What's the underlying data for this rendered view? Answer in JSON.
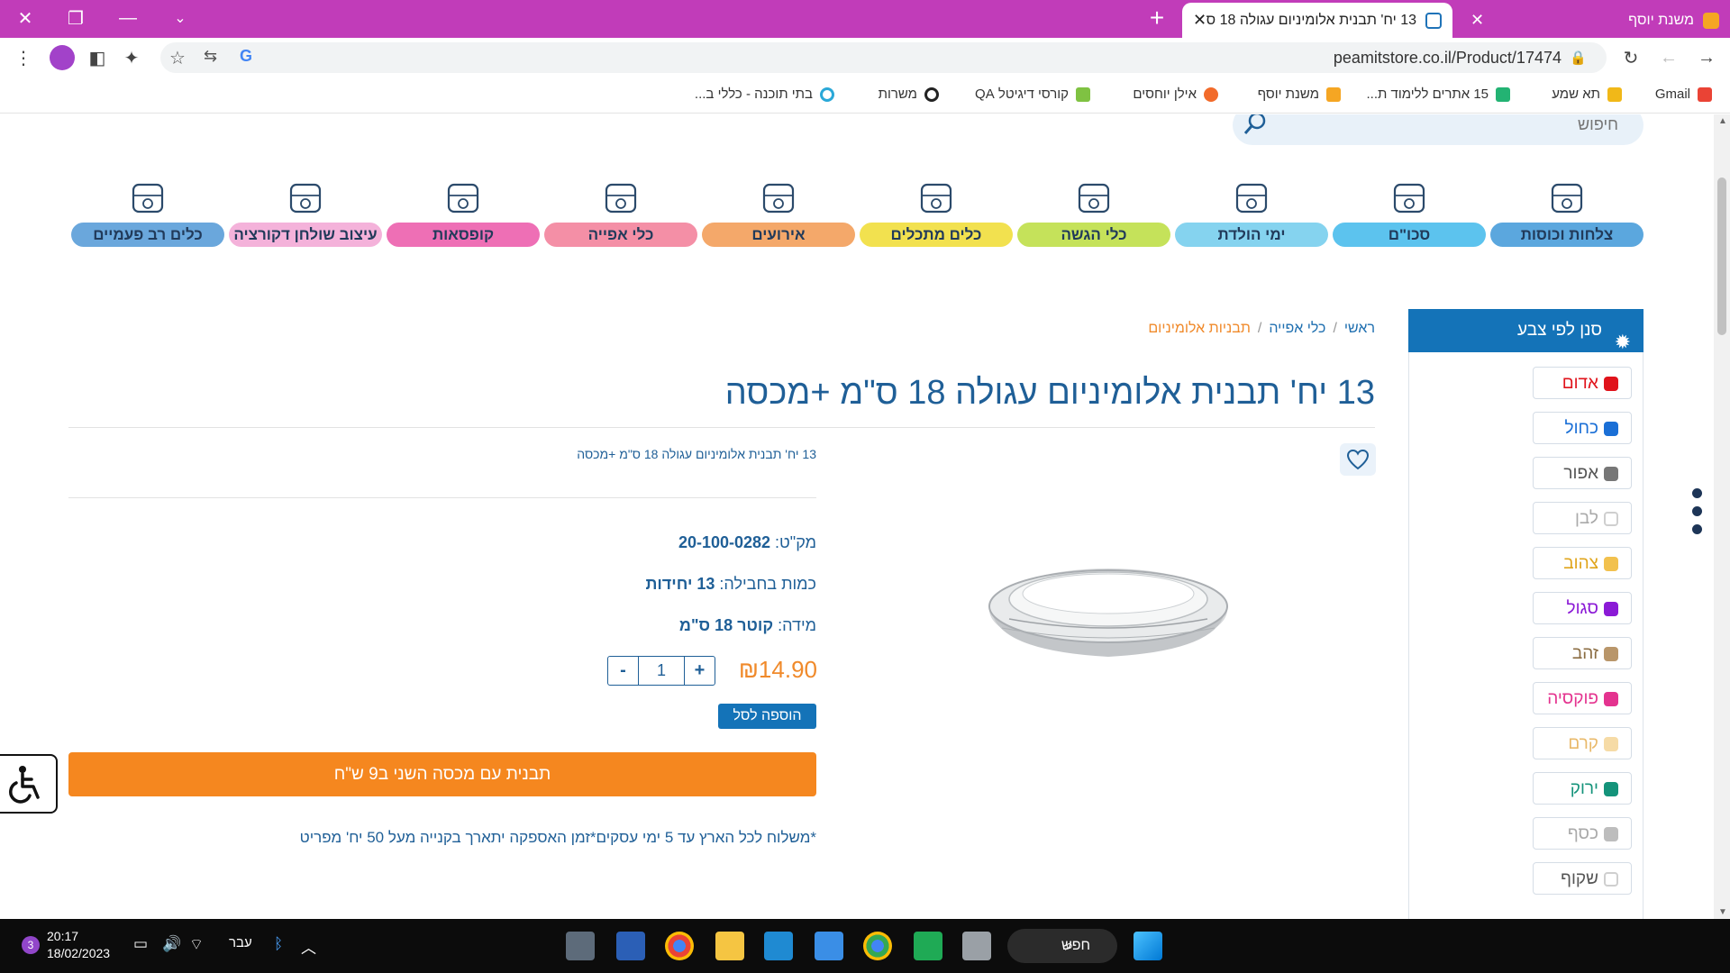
{
  "browser": {
    "tabs": [
      {
        "title": "13 יח' תבנית אלומיניום עגולה 18 ס",
        "active": true
      },
      {
        "title": "משנת יוסף",
        "active": false
      }
    ],
    "url": "peamitstore.co.il/Product/17474",
    "bookmarks": [
      "Gmail",
      "תא שמע",
      "15 אתרים ללימוד ת...",
      "משנת יוסף",
      "אילן יוחסים",
      "קורסי דיגיטל QA",
      "משרות",
      "בתי תוכנה - כללי ב..."
    ]
  },
  "site": {
    "search_placeholder": "חיפוש",
    "categories": [
      {
        "label": "צלחות וכוסות",
        "color": "#5ba7de",
        "icon": "cup-plate-icon"
      },
      {
        "label": "סכו\"ם",
        "color": "#5cc3ee",
        "icon": "cutlery-icon"
      },
      {
        "label": "ימי הולדת",
        "color": "#85d3ef",
        "icon": "balloons-icon"
      },
      {
        "label": "כלי הגשה",
        "color": "#c5e25a",
        "icon": "serving-dome-icon"
      },
      {
        "label": "כלים מתכלים",
        "color": "#f2e14f",
        "icon": "leaves-icon"
      },
      {
        "label": "אירועים",
        "color": "#f4a86a",
        "icon": "wine-glasses-icon"
      },
      {
        "label": "כלי אפייה",
        "color": "#f48fa6",
        "icon": "cupcake-icon"
      },
      {
        "label": "קופסאות",
        "color": "#ee6fb5",
        "icon": "boxes-icon"
      },
      {
        "label": "עיצוב שולחן דקורציה",
        "color": "#f4b2da",
        "icon": "tablecloth-icon"
      },
      {
        "label": "כלים רב פעמיים",
        "color": "#6aa7dc",
        "icon": "containers-icon"
      }
    ]
  },
  "filter": {
    "title": "סנן לפי צבע",
    "colors": [
      {
        "label": "אדום",
        "swatch": "#e0131b",
        "text": "#e0131b"
      },
      {
        "label": "כחול",
        "swatch": "#1a6fd6",
        "text": "#1a6fd6"
      },
      {
        "label": "אפור",
        "swatch": "#777777",
        "text": "#555555"
      },
      {
        "label": "לבן",
        "swatch": "#ffffff",
        "text": "#aaaaaa"
      },
      {
        "label": "צהוב",
        "swatch": "#f2c14e",
        "text": "#e0a51c"
      },
      {
        "label": "סגול",
        "swatch": "#8b1ad6",
        "text": "#8b1ad6"
      },
      {
        "label": "זהב",
        "swatch": "#b9966a",
        "text": "#8b6d43"
      },
      {
        "label": "פוקסיה",
        "swatch": "#e4338f",
        "text": "#e4338f"
      },
      {
        "label": "קרם",
        "swatch": "#f6dba6",
        "text": "#e9b96a"
      },
      {
        "label": "ירוק",
        "swatch": "#14937a",
        "text": "#14937a"
      },
      {
        "label": "כסף",
        "swatch": "#bdbdbd",
        "text": "#aaaaaa"
      },
      {
        "label": "שקוף",
        "swatch": "#ffffff",
        "text": "#555555"
      }
    ]
  },
  "product": {
    "breadcrumb": {
      "home": "ראשי",
      "category": "כלי אפייה",
      "current": "תבניות אלומיניום"
    },
    "title": "13 יח' תבנית אלומיניום עגולה 18 ס\"מ +מכסה",
    "subtitle": "13 יח' תבנית אלומיניום עגולה 18 ס\"מ +מכסה",
    "sku_label": "מק\"ט:",
    "sku": "20-100-0282",
    "qty_label": "כמות בחבילה:",
    "qty_value": "13 יחידות",
    "size_label": "מידה:",
    "size_value": "קוטר 18 ס\"מ",
    "price": "₪14.90",
    "quantity": "1",
    "minus": "-",
    "plus": "+",
    "add_to_cart": "הוספה לסל",
    "promo": "תבנית עם מכסה השני ב9 ש\"ח",
    "shipping": "*משלוח לכל הארץ עד 5 ימי עסקים*זמן האספקה יתארך בקנייה מעל 50 יח' מפריט"
  },
  "taskbar": {
    "search": "חפש",
    "lang": "עבר",
    "time": "20:17",
    "date": "18/02/2023",
    "notifications": "3"
  }
}
